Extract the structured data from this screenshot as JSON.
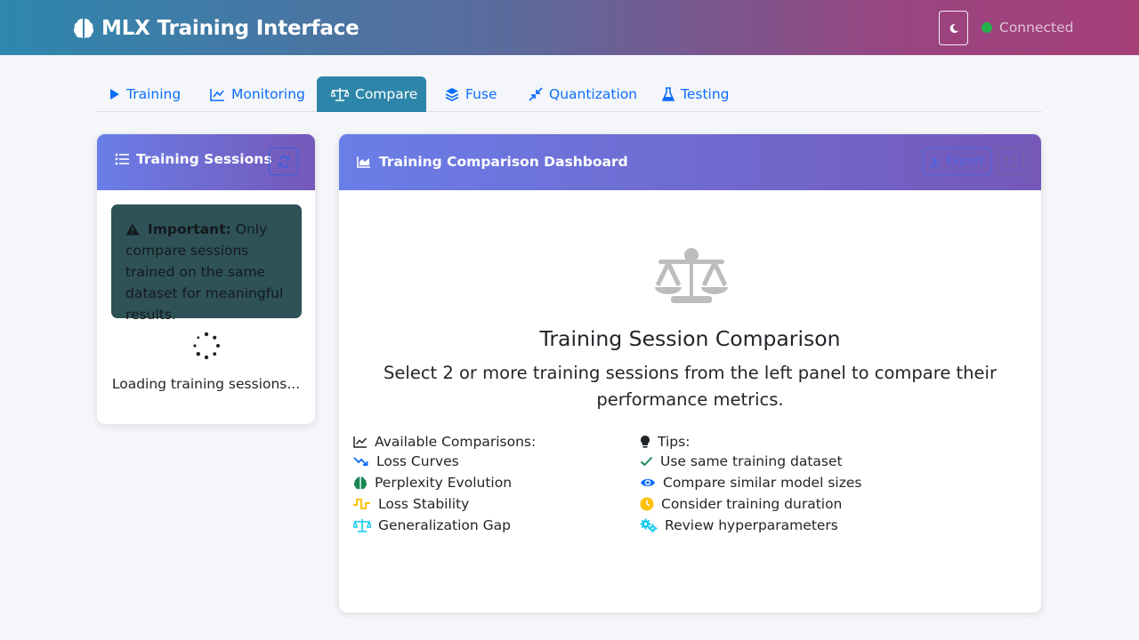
{
  "header": {
    "title": "MLX Training Interface",
    "status_text": "Connected",
    "status_color": "#24b04b",
    "brand_icon": "brain-icon",
    "theme_icon": "moon-icon"
  },
  "tabs": [
    {
      "label": "Training",
      "icon": "play-icon"
    },
    {
      "label": "Monitoring",
      "icon": "line-chart-icon"
    },
    {
      "label": "Compare",
      "icon": "scale-icon",
      "active": true
    },
    {
      "label": "Fuse",
      "icon": "layers-icon"
    },
    {
      "label": "Quantization",
      "icon": "compress-icon"
    },
    {
      "label": "Testing",
      "icon": "flask-icon"
    }
  ],
  "sessions": {
    "title": "Training Sessions",
    "warning_label": "Important:",
    "warning_text": "Only compare sessions trained on the same dataset for meaningful results.",
    "loading_text": "Loading training sessions..."
  },
  "dashboard": {
    "title": "Training Comparison Dashboard",
    "export_label": "Export",
    "heading": "Training Session Comparison",
    "description": "Select 2 or more training sessions from the left panel to compare their performance metrics.",
    "comparisons_title": "Available Comparisons:",
    "comparisons": [
      {
        "label": "Loss Curves",
        "icon": "trend-down-icon",
        "color": "#0d6efd"
      },
      {
        "label": "Perplexity Evolution",
        "icon": "brain-icon",
        "color": "#198754"
      },
      {
        "label": "Loss Stability",
        "icon": "wave-square-icon",
        "color": "#ffc107"
      },
      {
        "label": "Generalization Gap",
        "icon": "scale-icon",
        "color": "#0dcaf0"
      }
    ],
    "tips_title": "Tips:",
    "tips": [
      {
        "label": "Use same training dataset",
        "icon": "check-icon",
        "color": "#198754"
      },
      {
        "label": "Compare similar model sizes",
        "icon": "eye-icon",
        "color": "#0d6efd"
      },
      {
        "label": "Consider training duration",
        "icon": "clock-icon",
        "color": "#ffc107"
      },
      {
        "label": "Review hyperparameters",
        "icon": "cogs-icon",
        "color": "#0dcaf0"
      }
    ]
  }
}
